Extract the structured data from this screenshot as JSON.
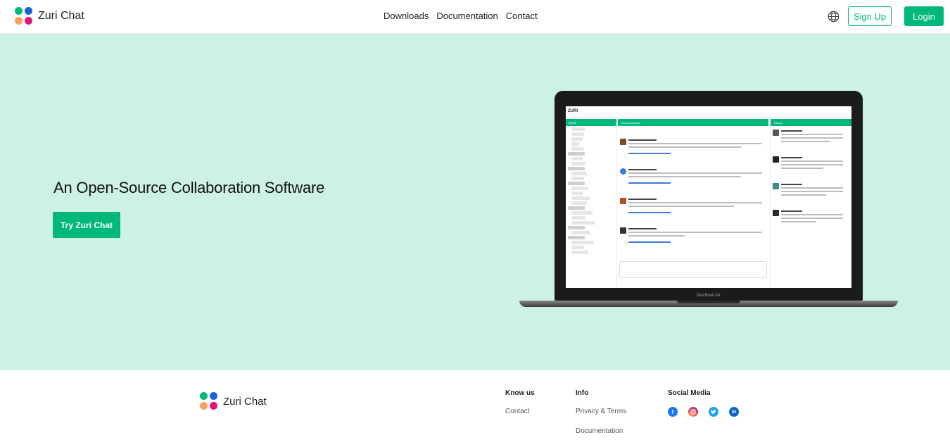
{
  "brand": {
    "name": "Zuri Chat"
  },
  "nav": {
    "items": [
      "Downloads",
      "Documentation",
      "Contact"
    ]
  },
  "header": {
    "signup_label": "Sign Up",
    "login_label": "Login",
    "language_icon": "globe-icon"
  },
  "hero": {
    "title": "An Open-Source Collaboration Software",
    "cta_label": "Try Zuri Chat",
    "device_label": "MacBook Air",
    "screen": {
      "app_logo": "ZURI",
      "org": "HNGi8",
      "channel": "Announcement",
      "thread_title": "Thread",
      "author": "Dreyto Cutting"
    }
  },
  "footer": {
    "know_us": {
      "heading": "Know us",
      "links": [
        "Contact"
      ]
    },
    "info": {
      "heading": "Info",
      "links": [
        "Privacy & Terms",
        "Documentation"
      ]
    },
    "social": {
      "heading": "Social Media",
      "icons": [
        "facebook-icon",
        "instagram-icon",
        "twitter-icon",
        "linkedin-icon"
      ]
    }
  },
  "colors": {
    "accent": "#00b87c",
    "hero_bg": "#cdf1e4"
  }
}
